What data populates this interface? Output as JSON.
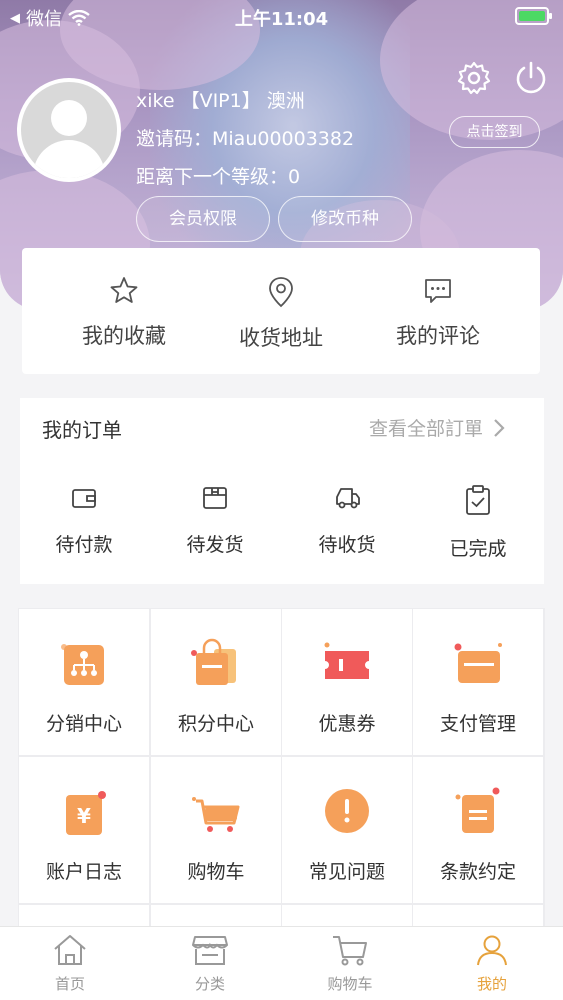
{
  "status_bar": {
    "back_app": "微信",
    "time": "上午11:04"
  },
  "user": {
    "name_line": "xike 【VIP1】 澳洲",
    "invite_code": "邀请码：Miau00003382",
    "next_level": "距离下一个等级：0"
  },
  "header": {
    "checkin_label": "点击签到",
    "member_rights_label": "会员权限",
    "change_currency_label": "修改币种"
  },
  "quick_links": [
    {
      "label": "我的收藏",
      "icon": "star-icon"
    },
    {
      "label": "收货地址",
      "icon": "location-pin-icon"
    },
    {
      "label": "我的评论",
      "icon": "comment-icon"
    }
  ],
  "orders": {
    "title": "我的订单",
    "view_all": "查看全部訂單",
    "items": [
      {
        "label": "待付款",
        "icon": "wallet-icon"
      },
      {
        "label": "待发货",
        "icon": "package-icon"
      },
      {
        "label": "待收货",
        "icon": "truck-icon"
      },
      {
        "label": "已完成",
        "icon": "clipboard-check-icon"
      }
    ]
  },
  "services": [
    {
      "label": "分销中心",
      "icon": "distribution-icon"
    },
    {
      "label": "积分中心",
      "icon": "points-bag-icon"
    },
    {
      "label": "优惠券",
      "icon": "coupon-icon"
    },
    {
      "label": "支付管理",
      "icon": "card-icon"
    },
    {
      "label": "账户日志",
      "icon": "yuan-log-icon"
    },
    {
      "label": "购物车",
      "icon": "cart-icon"
    },
    {
      "label": "常见问题",
      "icon": "faq-icon"
    },
    {
      "label": "条款约定",
      "icon": "terms-icon"
    }
  ],
  "tabbar": [
    {
      "label": "首页",
      "icon": "home-icon"
    },
    {
      "label": "分类",
      "icon": "store-icon"
    },
    {
      "label": "购物车",
      "icon": "cart-icon"
    },
    {
      "label": "我的",
      "icon": "user-icon",
      "active": true
    }
  ],
  "colors": {
    "accent": "#e6a23c",
    "icon_orange": "#f5a05a",
    "icon_red": "#f05a5a"
  }
}
